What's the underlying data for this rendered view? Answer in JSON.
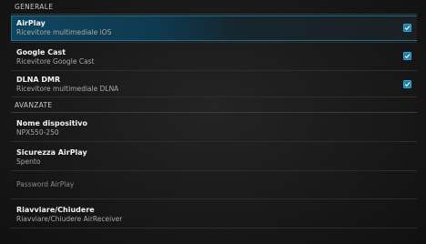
{
  "sections": {
    "general_label": "GENERALE",
    "advanced_label": "AVANZATE"
  },
  "general": [
    {
      "title": "AirPlay",
      "summary": "Ricevitore multimediale iOS",
      "checked": true
    },
    {
      "title": "Google Cast",
      "summary": "Ricevitore Google Cast",
      "checked": true
    },
    {
      "title": "DLNA DMR",
      "summary": "Ricevitore multimediale DLNA",
      "checked": true
    }
  ],
  "advanced": [
    {
      "title": "Nome dispositivo",
      "summary": "NPX550-250"
    },
    {
      "title": "Sicurezza AirPlay",
      "summary": "Spento"
    },
    {
      "title": "Password AirPlay"
    },
    {
      "title": "Riavviare/Chiudere",
      "summary": "Riavviare/Chiudere AirReceiver"
    }
  ],
  "colors": {
    "accent": "#1b7fa6",
    "selection": "#10415a"
  }
}
